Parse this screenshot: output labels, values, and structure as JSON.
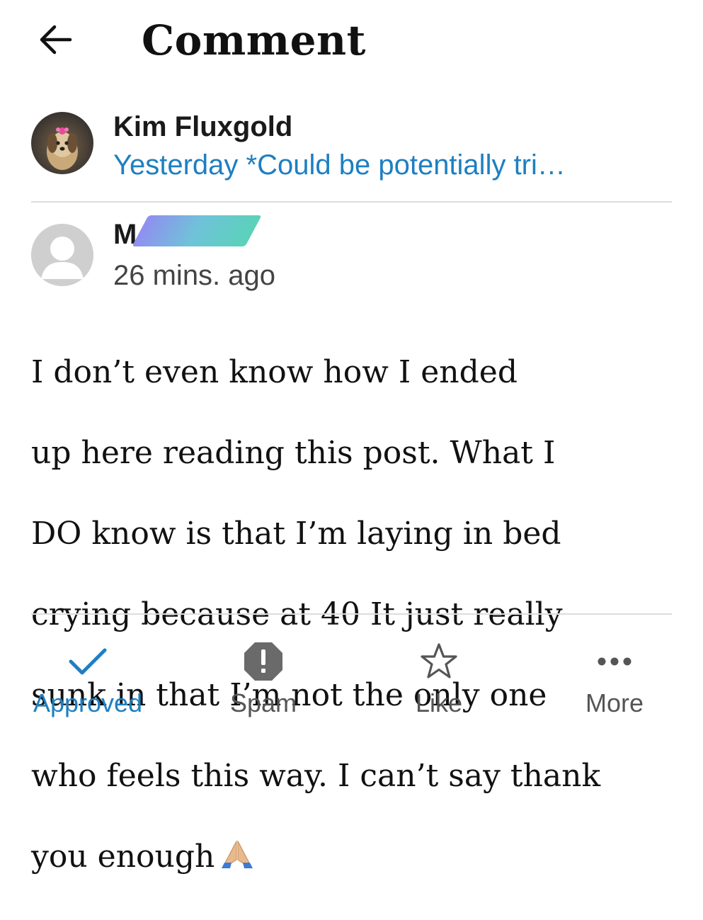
{
  "header": {
    "title": "Comment",
    "back_icon": "arrow-left-icon"
  },
  "post": {
    "author": "Kim Fluxgold",
    "meta": "Yesterday *Could be potentially tri…",
    "meta_color": "#1e7fc2"
  },
  "comment": {
    "author_visible": "M",
    "time": "26 mins. ago",
    "body_lines": [
      "I don’t even know how I ended",
      "up here reading this post. What I",
      "DO know is that I’m laying in bed",
      "crying because at 40 It just really",
      "sunk in that I’m not the only one",
      "who feels this way. I can’t say thank",
      "you enough"
    ],
    "emoji": "folded-hands-icon"
  },
  "actions": [
    {
      "label": "Approved",
      "icon": "checkmark-icon",
      "active": true
    },
    {
      "label": "Spam",
      "icon": "spam-octagon-icon",
      "active": false
    },
    {
      "label": "Like",
      "icon": "star-outline-icon",
      "active": false
    },
    {
      "label": "More",
      "icon": "more-dots-icon",
      "active": false
    }
  ],
  "colors": {
    "accent": "#1e7fc2",
    "text": "#111111",
    "secondary": "#555555",
    "divider": "#dcdcdc"
  }
}
